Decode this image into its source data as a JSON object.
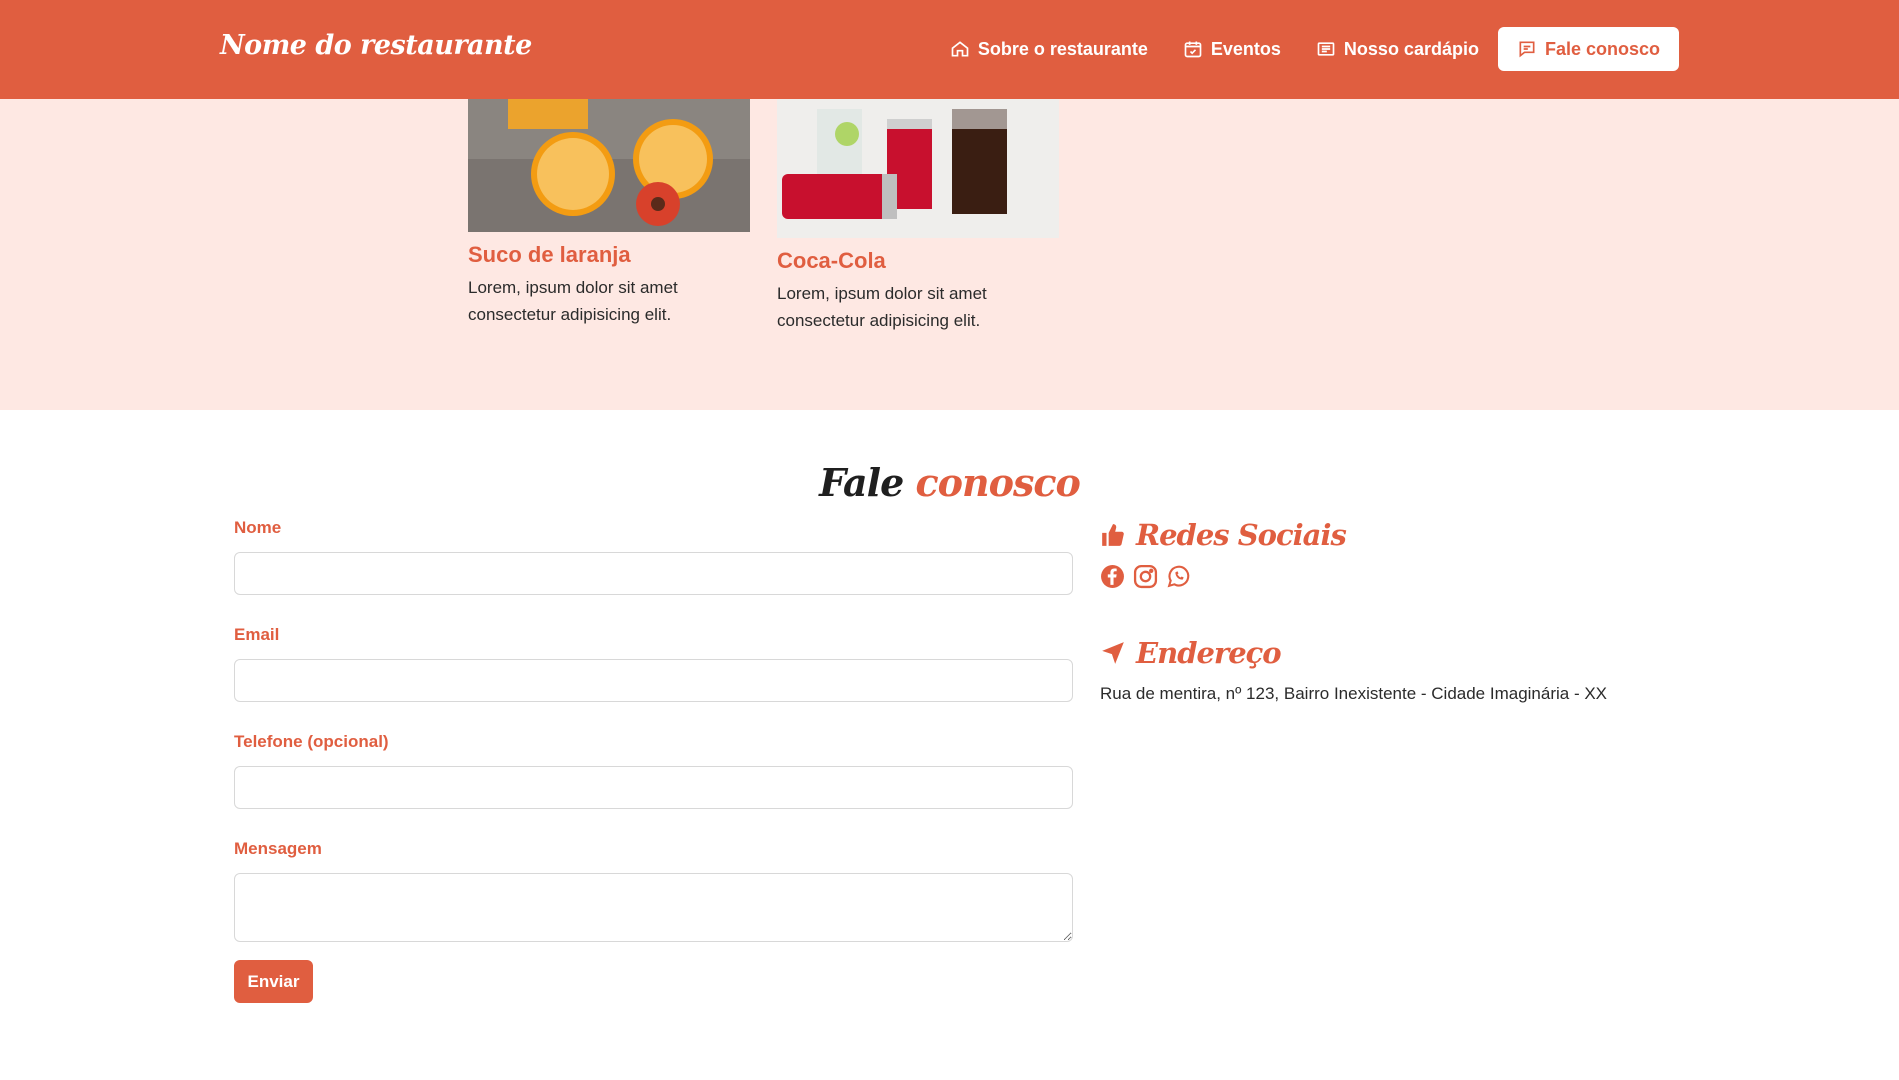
{
  "header": {
    "brand": "Nome do restaurante",
    "nav": [
      {
        "label": "Sobre o restaurante",
        "icon": "home-icon"
      },
      {
        "label": "Eventos",
        "icon": "calendar-check-icon"
      },
      {
        "label": "Nosso cardápio",
        "icon": "menu-card-icon"
      },
      {
        "label": "Fale conosco",
        "icon": "chat-icon",
        "active": true
      }
    ]
  },
  "drinks": [
    {
      "title": "Suco de laranja",
      "text": "Lorem, ipsum dolor sit amet consectetur adipisicing elit.",
      "image": "orange-juice-photo"
    },
    {
      "title": "Coca-Cola",
      "text": "Lorem, ipsum dolor sit amet consectetur adipisicing elit.",
      "image": "coca-cola-photo"
    }
  ],
  "contact": {
    "title_part1": "Fale",
    "title_part2": "conosco",
    "fields": {
      "name_label": "Nome",
      "email_label": "Email",
      "phone_label": "Telefone (opcional)",
      "message_label": "Mensagem"
    },
    "submit_label": "Enviar",
    "social_title": "Redes Sociais",
    "social_icons": [
      "facebook-icon",
      "instagram-icon",
      "whatsapp-icon"
    ],
    "address_title": "Endereço",
    "address": "Rua de mentira, nº 123, Bairro Inexistente - Cidade Imaginária - XX"
  },
  "colors": {
    "brand": "#e05e40",
    "section_bg": "#fee8e3"
  }
}
